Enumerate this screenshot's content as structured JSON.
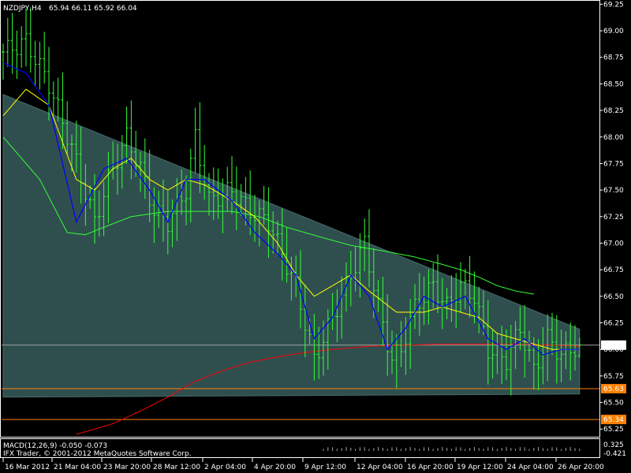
{
  "header": {
    "symbol_line": "NZDJPY,H4",
    "ohlc_line": "65.94 66.11 65.92 66.04"
  },
  "footer": {
    "indicator_title": "MACD(12,26,9) -0.050 -0.073",
    "broker": "IFX Trader, © 2001-2012 MetaQuotes Software Corp."
  },
  "colors": {
    "background": "#000000",
    "bars": "#33ff33",
    "fast_ma": "#0000ff",
    "mid_ma": "#ffff00",
    "slow_ma": "#33ff33",
    "long_ma": "#ff0000",
    "triangle_fill": "#2f4f4f",
    "support_lines": "#ff8000",
    "grid_text": "#ffffff"
  },
  "chart_data": {
    "type": "candlestick",
    "title": "NZDJPY,H4",
    "ylim": [
      65.17,
      69.29
    ],
    "y_ticks": [
      "69.25",
      "69.00",
      "68.75",
      "68.50",
      "68.25",
      "68.00",
      "67.75",
      "67.50",
      "67.25",
      "67.00",
      "66.75",
      "66.50",
      "66.25",
      "66.00",
      "65.75",
      "65.50",
      "65.25"
    ],
    "x_ticks": [
      "16 Mar 2012",
      "21 Mar 04:00",
      "23 Mar 20:00",
      "28 Mar 12:00",
      "2 Apr 04:00",
      "4 Apr 20:00",
      "9 Apr 12:00",
      "12 Apr 04:00",
      "16 Apr 20:00",
      "19 Apr 12:00",
      "24 Apr 04:00",
      "26 Apr 20:00"
    ],
    "current_price": "66.04",
    "price_tags": [
      {
        "label": "66.04",
        "value": 66.04,
        "color": "#ffffff"
      },
      {
        "label": "65.63",
        "value": 65.63,
        "color": "#ff8000"
      },
      {
        "label": "65.34",
        "value": 65.34,
        "color": "#ff8000"
      }
    ],
    "triangle": [
      [
        0,
        68.4
      ],
      [
        126,
        66.19
      ],
      [
        126,
        65.58
      ],
      [
        0,
        65.55
      ]
    ],
    "macd_ticks": [
      "0.325",
      "-0.421"
    ],
    "bars": {
      "count": 127,
      "close_anchors": [
        [
          0,
          68.8
        ],
        [
          5,
          68.9
        ],
        [
          10,
          68.5
        ],
        [
          15,
          67.9
        ],
        [
          20,
          67.2
        ],
        [
          23,
          67.6
        ],
        [
          27,
          68.0
        ],
        [
          30,
          67.7
        ],
        [
          33,
          67.3
        ],
        [
          36,
          67.2
        ],
        [
          40,
          67.5
        ],
        [
          42,
          68.0
        ],
        [
          45,
          67.4
        ],
        [
          50,
          67.5
        ],
        [
          54,
          67.3
        ],
        [
          58,
          67.2
        ],
        [
          62,
          66.8
        ],
        [
          64,
          66.6
        ],
        [
          68,
          65.9
        ],
        [
          72,
          66.3
        ],
        [
          76,
          66.7
        ],
        [
          79,
          67.0
        ],
        [
          82,
          66.4
        ],
        [
          85,
          65.9
        ],
        [
          87,
          66.0
        ],
        [
          90,
          66.4
        ],
        [
          94,
          66.6
        ],
        [
          97,
          66.4
        ],
        [
          100,
          66.6
        ],
        [
          103,
          66.5
        ],
        [
          106,
          66.0
        ],
        [
          110,
          65.9
        ],
        [
          113,
          66.2
        ],
        [
          116,
          65.8
        ],
        [
          119,
          66.1
        ],
        [
          122,
          65.95
        ],
        [
          126,
          66.04
        ]
      ],
      "last": {
        "open": 65.94,
        "high": 66.11,
        "low": 65.92,
        "close": 66.04
      }
    },
    "fast_ma_anchors": [
      [
        0,
        68.7
      ],
      [
        5,
        68.6
      ],
      [
        10,
        68.3
      ],
      [
        16,
        67.2
      ],
      [
        22,
        67.7
      ],
      [
        27,
        67.8
      ],
      [
        32,
        67.5
      ],
      [
        36,
        67.2
      ],
      [
        40,
        67.6
      ],
      [
        44,
        67.6
      ],
      [
        50,
        67.4
      ],
      [
        55,
        67.1
      ],
      [
        60,
        66.9
      ],
      [
        64,
        66.7
      ],
      [
        68,
        66.1
      ],
      [
        72,
        66.3
      ],
      [
        76,
        66.7
      ],
      [
        80,
        66.5
      ],
      [
        84,
        66.0
      ],
      [
        88,
        66.2
      ],
      [
        92,
        66.5
      ],
      [
        96,
        66.4
      ],
      [
        101,
        66.5
      ],
      [
        106,
        66.1
      ],
      [
        110,
        66.0
      ],
      [
        114,
        66.1
      ],
      [
        118,
        65.95
      ],
      [
        122,
        66.0
      ],
      [
        126,
        66.0
      ]
    ],
    "mid_ma_anchors": [
      [
        0,
        68.2
      ],
      [
        5,
        68.45
      ],
      [
        10,
        68.3
      ],
      [
        16,
        67.6
      ],
      [
        20,
        67.5
      ],
      [
        24,
        67.7
      ],
      [
        28,
        67.8
      ],
      [
        32,
        67.6
      ],
      [
        36,
        67.5
      ],
      [
        40,
        67.6
      ],
      [
        44,
        67.55
      ],
      [
        50,
        67.4
      ],
      [
        55,
        67.25
      ],
      [
        60,
        67.0
      ],
      [
        64,
        66.7
      ],
      [
        68,
        66.5
      ],
      [
        72,
        66.6
      ],
      [
        76,
        66.7
      ],
      [
        80,
        66.55
      ],
      [
        86,
        66.35
      ],
      [
        92,
        66.35
      ],
      [
        96,
        66.4
      ],
      [
        100,
        66.35
      ],
      [
        104,
        66.3
      ],
      [
        108,
        66.15
      ],
      [
        112,
        66.1
      ],
      [
        116,
        66.05
      ],
      [
        120,
        66.0
      ],
      [
        126,
        66.0
      ]
    ],
    "slow_ma_anchors": [
      [
        0,
        68.0
      ],
      [
        8,
        67.6
      ],
      [
        14,
        67.1
      ],
      [
        18,
        67.08
      ],
      [
        22,
        67.15
      ],
      [
        28,
        67.25
      ],
      [
        36,
        67.3
      ],
      [
        44,
        67.3
      ],
      [
        50,
        67.3
      ],
      [
        56,
        67.25
      ],
      [
        62,
        67.15
      ],
      [
        70,
        67.05
      ],
      [
        76,
        66.98
      ],
      [
        84,
        66.92
      ],
      [
        90,
        66.87
      ],
      [
        96,
        66.8
      ],
      [
        100,
        66.75
      ],
      [
        104,
        66.68
      ],
      [
        108,
        66.6
      ],
      [
        112,
        66.55
      ],
      [
        116,
        66.52
      ]
    ],
    "long_ma_anchors": [
      [
        16,
        65.2
      ],
      [
        24,
        65.3
      ],
      [
        30,
        65.42
      ],
      [
        36,
        65.55
      ],
      [
        42,
        65.7
      ],
      [
        48,
        65.8
      ],
      [
        54,
        65.88
      ],
      [
        60,
        65.93
      ],
      [
        66,
        65.97
      ],
      [
        72,
        66.0
      ],
      [
        80,
        66.03
      ],
      [
        88,
        66.04
      ],
      [
        96,
        66.05
      ],
      [
        104,
        66.05
      ],
      [
        112,
        66.05
      ],
      [
        120,
        66.04
      ],
      [
        126,
        66.03
      ]
    ]
  }
}
